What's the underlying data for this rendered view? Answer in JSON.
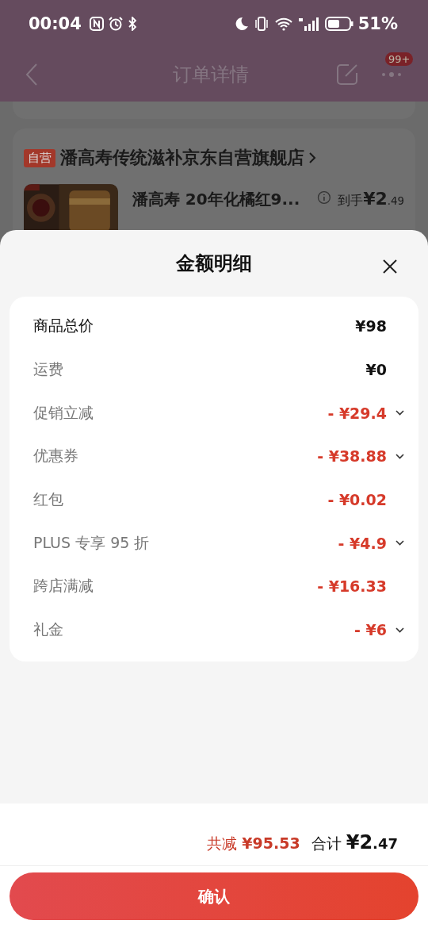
{
  "status_bar": {
    "time": "00:04",
    "battery": "51%"
  },
  "nav": {
    "title": "订单详情",
    "badge": "99+"
  },
  "store": {
    "badge": "自营",
    "name": "潘高寿传统滋补京东自营旗舰店"
  },
  "product": {
    "kind": "picture",
    "name": "潘高寿 20年化橘红9...",
    "price_label": "到手",
    "price": "¥2.49"
  },
  "sheet": {
    "title": "金额明细",
    "rows": [
      {
        "label": "商品总价",
        "value": "¥98",
        "primary": true,
        "negative": false,
        "expandable": false
      },
      {
        "label": "运费",
        "value": "¥0",
        "primary": false,
        "negative": false,
        "expandable": false
      },
      {
        "label": "促销立减",
        "value": "- ¥29.4",
        "primary": false,
        "negative": true,
        "expandable": true
      },
      {
        "label": "优惠券",
        "value": "- ¥38.88",
        "primary": false,
        "negative": true,
        "expandable": true
      },
      {
        "label": "红包",
        "value": "- ¥0.02",
        "primary": false,
        "negative": true,
        "expandable": false
      },
      {
        "label": "PLUS 专享 95 折",
        "value": "- ¥4.9",
        "primary": false,
        "negative": true,
        "expandable": true
      },
      {
        "label": "跨店满减",
        "value": "- ¥16.33",
        "primary": false,
        "negative": true,
        "expandable": false
      },
      {
        "label": "礼金",
        "value": "- ¥6",
        "primary": false,
        "negative": true,
        "expandable": true
      }
    ],
    "saved_label": "共减",
    "saved": "¥95.53",
    "total_label": "合计",
    "total": "¥2.47",
    "confirm": "确认"
  }
}
